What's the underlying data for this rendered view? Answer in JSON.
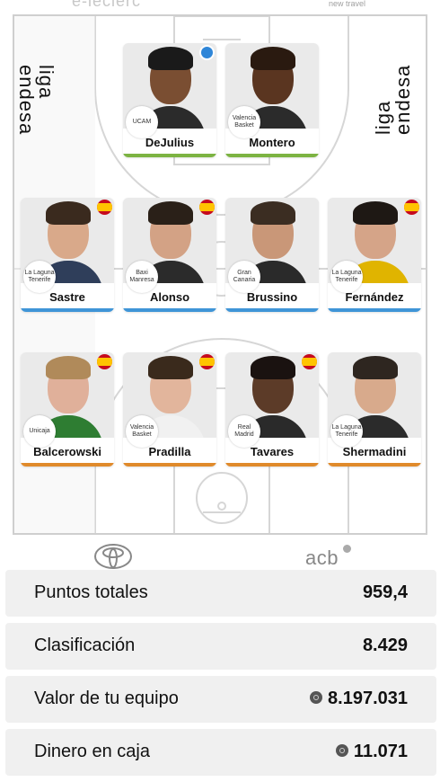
{
  "top_brands": {
    "left": "e-leclerc",
    "right": "new travel"
  },
  "court": {
    "liga_left": "liga\nendesa",
    "liga_right": "liga\nendesa"
  },
  "players": [
    {
      "name": "DeJulius",
      "team_logo": "UCAM",
      "badge": "blue-badge-icon",
      "bar": "green"
    },
    {
      "name": "Montero",
      "team_logo": "Valencia Basket",
      "badge": "",
      "bar": "green"
    },
    {
      "name": "Sastre",
      "team_logo": "La Laguna Tenerife",
      "badge": "spain-flag-icon",
      "bar": "blue"
    },
    {
      "name": "Alonso",
      "team_logo": "Baxi Manresa",
      "badge": "spain-flag-icon",
      "bar": "blue"
    },
    {
      "name": "Brussino",
      "team_logo": "Gran Canaria",
      "badge": "",
      "bar": "blue"
    },
    {
      "name": "Fernández",
      "team_logo": "La Laguna Tenerife",
      "badge": "spain-flag-icon",
      "bar": "blue"
    },
    {
      "name": "Balcerowski",
      "team_logo": "Unicaja",
      "badge": "spain-flag-icon",
      "bar": "orange"
    },
    {
      "name": "Pradilla",
      "team_logo": "Valencia Basket",
      "badge": "spain-flag-icon",
      "bar": "orange"
    },
    {
      "name": "Tavares",
      "team_logo": "Real Madrid",
      "badge": "spain-flag-icon",
      "bar": "orange"
    },
    {
      "name": "Shermadini",
      "team_logo": "La Laguna Tenerife",
      "badge": "",
      "bar": "orange"
    }
  ],
  "sponsors": {
    "acb": "acb"
  },
  "stats": [
    {
      "label": "Puntos totales",
      "value": "959,4",
      "coin": false
    },
    {
      "label": "Clasificación",
      "value": "8.429",
      "coin": false
    },
    {
      "label": "Valor de tu equipo",
      "value": "8.197.031",
      "coin": true
    },
    {
      "label": "Dinero en caja",
      "value": "11.071",
      "coin": true
    }
  ]
}
